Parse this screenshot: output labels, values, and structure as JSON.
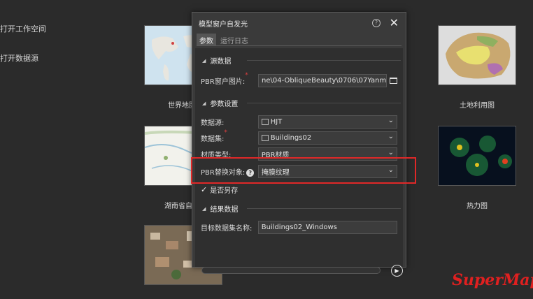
{
  "left_menu": [
    "打开工作空间",
    "打开数据源"
  ],
  "thumbnails": [
    {
      "caption": "世界地图"
    },
    {
      "caption": "土地利用图"
    },
    {
      "caption": "湖南省自然"
    },
    {
      "caption": "热力图"
    }
  ],
  "dialog": {
    "title": "模型窗户自发光",
    "help": "?",
    "close": "✕",
    "tabs": [
      "参数",
      "运行日志"
    ],
    "sections": {
      "source": "源数据",
      "params": "参数设置",
      "result": "结果数据"
    },
    "fields": {
      "pbr_image_label": "PBR窗户图片:",
      "pbr_image_value": "ne\\04-ObliqueBeauty\\0706\\07Yanmo",
      "datasource_label": "数据源:",
      "datasource_value": "HJT",
      "dataset_label": "数据集:",
      "dataset_value": "Buildings02",
      "material_label": "材质类型:",
      "material_value": "PBR材质",
      "replace_label": "PBR替换对象:",
      "replace_value": "掩膜纹理",
      "save_as_label": "是否另存",
      "target_label": "目标数据集名称:",
      "target_value": "Buildings02_Windows"
    },
    "progress": 0
  },
  "logo": "SuperMap",
  "colors": {
    "highlight": "#e02828",
    "accent": "#e02020"
  }
}
